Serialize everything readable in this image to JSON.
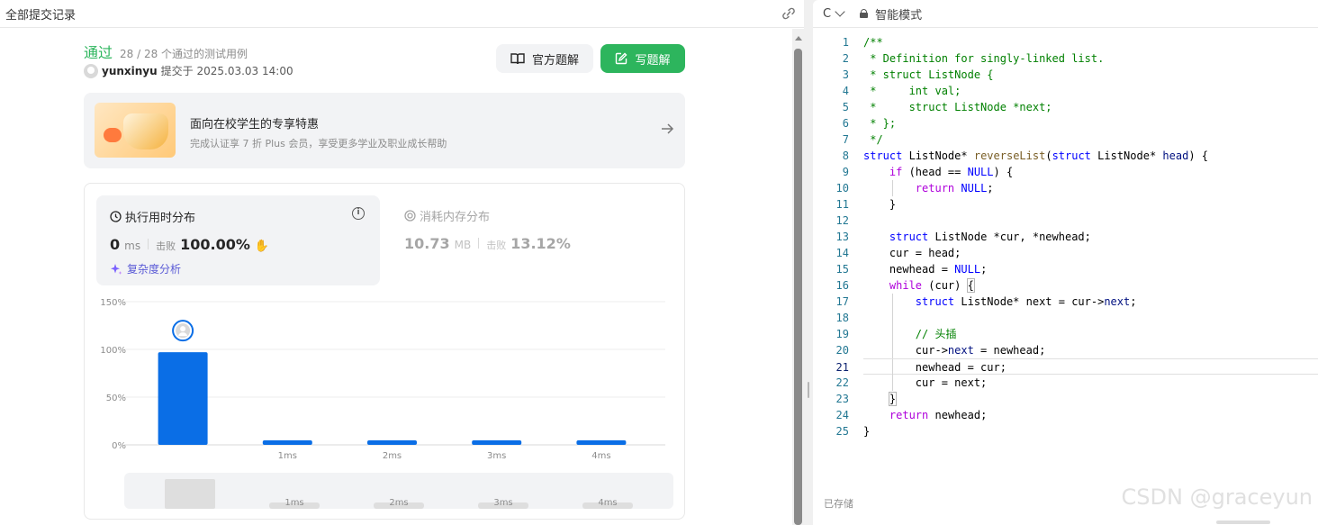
{
  "left_header": {
    "title": "全部提交记录"
  },
  "submission": {
    "status": "通过",
    "cases": "28 / 28 个通过的测试用例",
    "username": "yunxinyu",
    "submitted_at": "提交于 2025.03.03 14:00"
  },
  "buttons": {
    "official": "官方题解",
    "write": "写题解"
  },
  "promo": {
    "title": "面向在校学生的专享特惠",
    "subtitle": "完成认证享 7 折 Plus 会员，享受更多学业及职业成长帮助"
  },
  "runtime": {
    "title": "执行用时分布",
    "value": "0",
    "unit": "ms",
    "beat_label": "击败",
    "beat_value": "100.00%",
    "complexity_link": "复杂度分析"
  },
  "memory": {
    "title": "消耗内存分布",
    "value": "10.73",
    "unit": "MB",
    "beat_label": "击败",
    "beat_value": "13.12%"
  },
  "chart_data": {
    "type": "bar",
    "categories": [
      "0ms",
      "1ms",
      "2ms",
      "3ms",
      "4ms"
    ],
    "category_labels": [
      "",
      "1ms",
      "2ms",
      "3ms",
      "4ms"
    ],
    "values": [
      97,
      3,
      3,
      3,
      3
    ],
    "ylim": [
      0,
      150
    ],
    "yticks": [
      "0%",
      "50%",
      "100%",
      "150%"
    ],
    "ytick_values": [
      0,
      50,
      100,
      150
    ],
    "highlight_index": 0,
    "grid": true,
    "bar_color": "#0a6ee6",
    "overview_labels": [
      "1ms",
      "2ms",
      "3ms",
      "4ms"
    ]
  },
  "editor": {
    "language": "C",
    "mode": "智能模式",
    "saved_status": "已存储",
    "active_line": 21,
    "watermark": "CSDN @graceyun"
  }
}
